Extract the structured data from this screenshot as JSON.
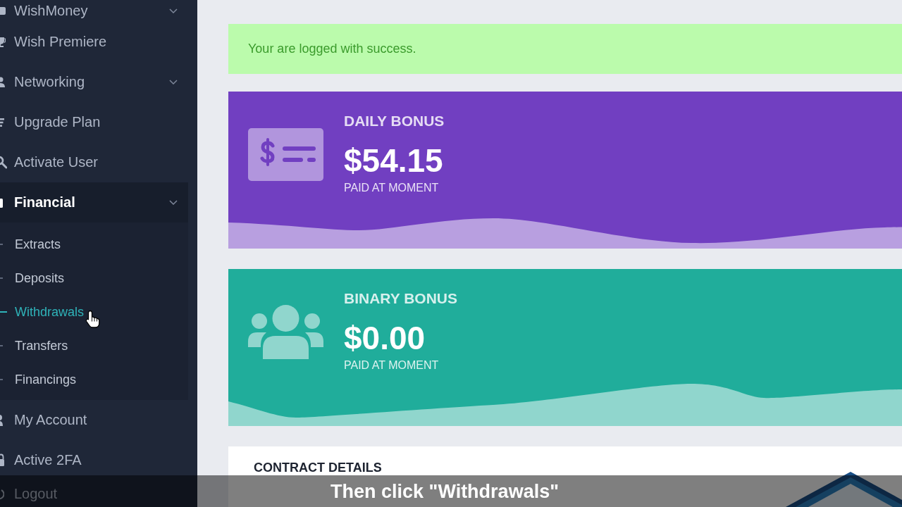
{
  "sidebar": {
    "items": [
      {
        "label": "WishMoney",
        "kind": "group",
        "selected": false
      },
      {
        "label": "Wish Premiere",
        "kind": "link",
        "selected": false
      },
      {
        "label": "Networking",
        "kind": "group",
        "selected": false
      },
      {
        "label": "Upgrade Plan",
        "kind": "link",
        "selected": false
      },
      {
        "label": "Activate User",
        "kind": "link",
        "selected": false
      },
      {
        "label": "Financial",
        "kind": "group",
        "selected": true,
        "children": [
          {
            "label": "Extracts",
            "selected": false
          },
          {
            "label": "Deposits",
            "selected": false
          },
          {
            "label": "Withdrawals",
            "selected": true
          },
          {
            "label": "Transfers",
            "selected": false
          },
          {
            "label": "Financings",
            "selected": false
          }
        ]
      },
      {
        "label": "My Account",
        "kind": "link",
        "selected": false
      },
      {
        "label": "Active 2FA",
        "kind": "link",
        "selected": false
      },
      {
        "label": "Logout",
        "kind": "link",
        "selected": false
      }
    ]
  },
  "alert": {
    "kind": "success",
    "text": "Your are logged with success."
  },
  "cards": [
    {
      "kind": "cash",
      "title": "DAILY BONUS",
      "value": "$54.15",
      "caption": "PAID AT MOMENT",
      "color": "#713fc1"
    },
    {
      "kind": "team",
      "title": "BINARY BONUS",
      "value": "$0.00",
      "caption": "PAID AT MOMENT",
      "color": "#20ad9b"
    }
  ],
  "contract_card": {
    "title": "CONTRACT DETAILS"
  },
  "caption": {
    "text": "Then click \"Withdrawals\""
  }
}
